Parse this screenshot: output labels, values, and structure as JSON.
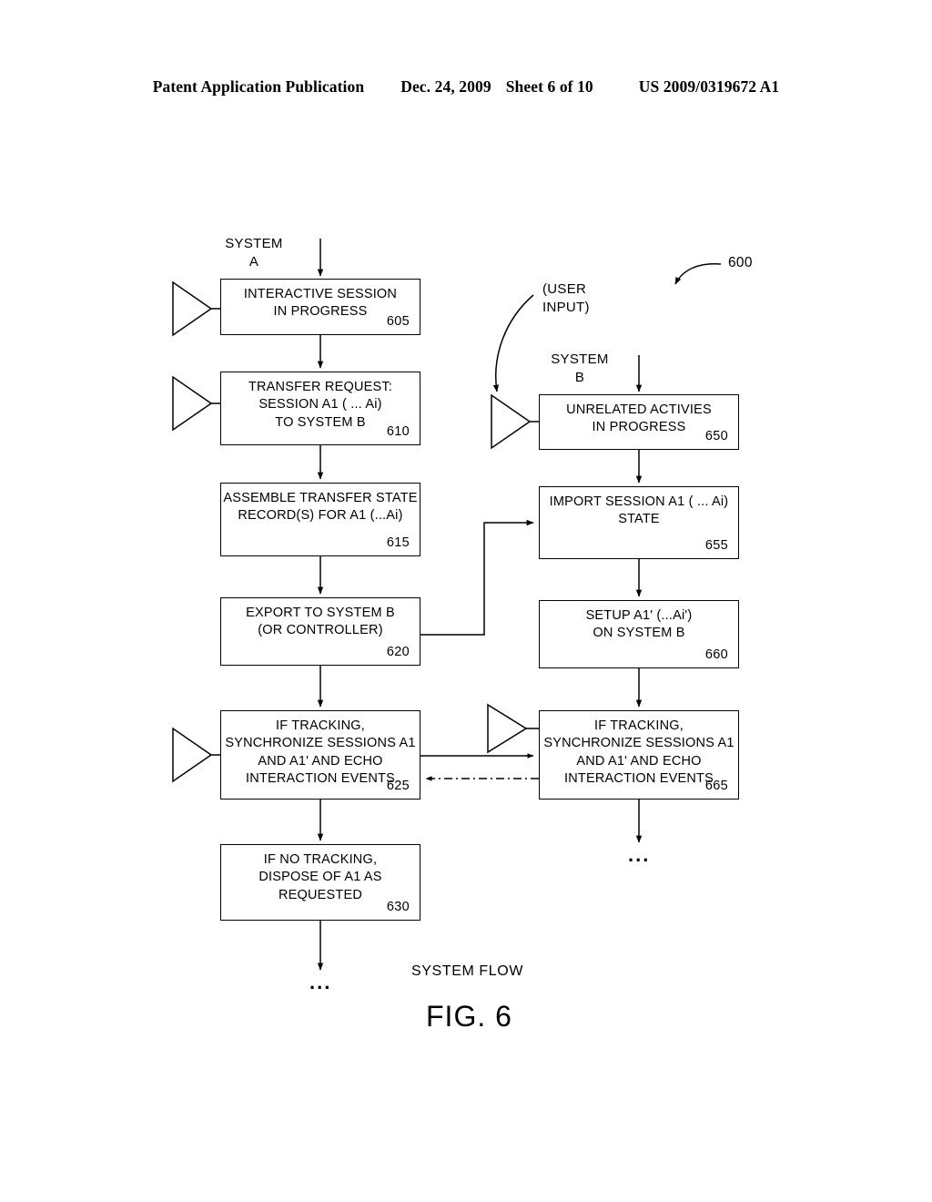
{
  "header": {
    "publication": "Patent Application Publication",
    "date": "Dec. 24, 2009",
    "sheet": "Sheet 6 of 10",
    "patent_number": "US 2009/0319672 A1"
  },
  "figure": {
    "caption": "FIG. 6",
    "flow_caption": "SYSTEM FLOW",
    "diagram_reference": "600"
  },
  "labels": {
    "system_a": "SYSTEM\nA",
    "system_b": "SYSTEM\nB",
    "user_input": "(USER\nINPUT)",
    "ellipsis": "..."
  },
  "system_a_boxes": [
    {
      "id": "605",
      "text": "INTERACTIVE SESSION\nIN PROGRESS",
      "ref": "605",
      "has_actor_icon": true
    },
    {
      "id": "610",
      "text": "TRANSFER REQUEST:\nSESSION A1 ( ... Ai)\nTO SYSTEM B",
      "ref": "610",
      "has_actor_icon": true
    },
    {
      "id": "615",
      "text": "ASSEMBLE TRANSFER STATE\nRECORD(S) FOR A1 (...Ai)",
      "ref": "615",
      "has_actor_icon": false
    },
    {
      "id": "620",
      "text": "EXPORT TO SYSTEM B\n(OR CONTROLLER)",
      "ref": "620",
      "has_actor_icon": false
    },
    {
      "id": "625",
      "text": "IF TRACKING,\nSYNCHRONIZE SESSIONS A1\nAND A1' AND ECHO\nINTERACTION EVENTS",
      "ref": "625",
      "has_actor_icon": true
    },
    {
      "id": "630",
      "text": "IF NO TRACKING,\nDISPOSE OF A1 AS REQUESTED",
      "ref": "630",
      "has_actor_icon": false
    }
  ],
  "system_b_boxes": [
    {
      "id": "650",
      "text": "UNRELATED ACTIVIES\nIN PROGRESS",
      "ref": "650",
      "has_actor_icon": true
    },
    {
      "id": "655",
      "text": "IMPORT SESSION A1 ( ... Ai)\nSTATE",
      "ref": "655",
      "has_actor_icon": false
    },
    {
      "id": "660",
      "text": "SETUP A1' (...Ai')\nON SYSTEM B",
      "ref": "660",
      "has_actor_icon": false
    },
    {
      "id": "665",
      "text": "IF TRACKING,\nSYNCHRONIZE SESSIONS A1\nAND A1' AND ECHO\nINTERACTION EVENTS",
      "ref": "665",
      "has_actor_icon": true
    }
  ],
  "colors": {
    "ink": "#000000",
    "paper": "#ffffff"
  }
}
